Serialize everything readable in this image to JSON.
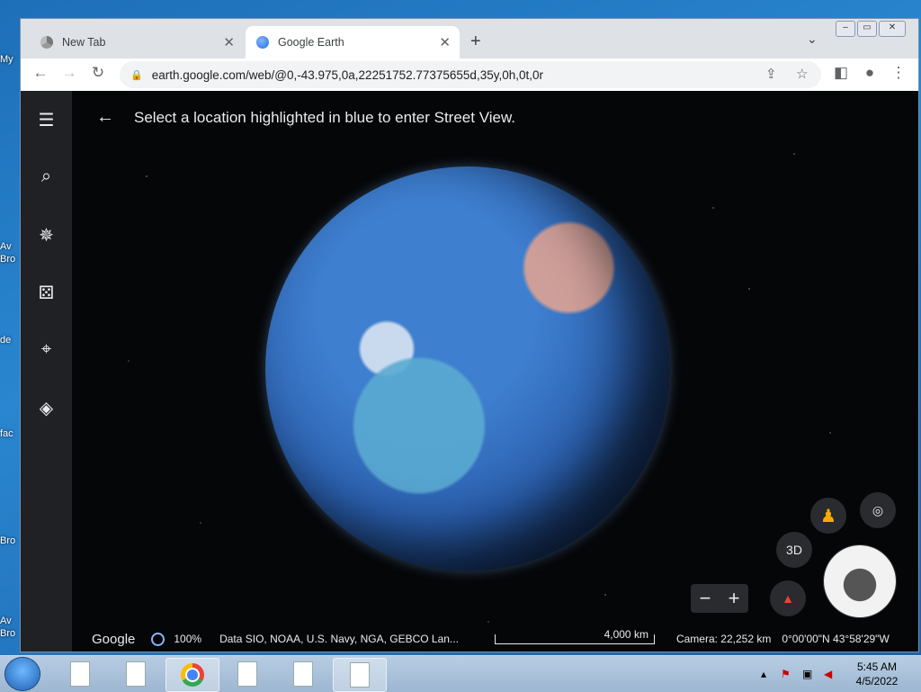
{
  "desktop": {
    "labels": [
      "My",
      "Av",
      "Bro",
      "de",
      "fac",
      "Bro",
      "Av",
      "Bro"
    ]
  },
  "browser": {
    "tabs": [
      {
        "label": "New Tab",
        "active": false
      },
      {
        "label": "Google Earth",
        "active": true
      }
    ],
    "new_tab_icon": "+",
    "tab_menu_icon": "⌄",
    "url": "earth.google.com/web/@0,-43.975,0a,22251752.77375655d,35y,0h,0t,0r"
  },
  "earth": {
    "banner": "Select a location highlighted in blue to enter Street View.",
    "sidebar": [
      "menu-icon",
      "search-icon",
      "voyager-icon",
      "feeling-lucky-icon",
      "projects-icon",
      "map-style-icon"
    ],
    "controls": {
      "mode_3d": "3D",
      "zoom_out": "−",
      "zoom_in": "+"
    },
    "footer": {
      "logo": "Google",
      "loading": "100%",
      "attribution": "Data SIO, NOAA, U.S. Navy, NGA, GEBCO  Lan...",
      "scale": "4,000 km",
      "camera": "Camera: 22,252 km",
      "coordinates": "0°00'00\"N 43°58'29\"W"
    }
  },
  "taskbar": {
    "time": "5:45 AM",
    "date": "4/5/2022"
  }
}
